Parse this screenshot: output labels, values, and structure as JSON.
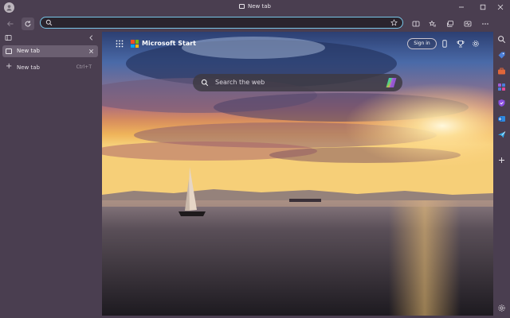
{
  "window": {
    "title": "New tab"
  },
  "addressbar": {
    "value": "",
    "placeholder": ""
  },
  "sidebar": {
    "tabs": [
      {
        "label": "New tab"
      }
    ],
    "new_tab": {
      "label": "New tab",
      "shortcut": "Ctrl+T"
    }
  },
  "ntp": {
    "brand": "Microsoft Start",
    "sign_in": "Sign in",
    "search_placeholder": "Search the web"
  },
  "colors": {
    "chrome": "#4a3e50",
    "tab_active": "#6b5f71",
    "address_focus": "#78c6e8"
  }
}
